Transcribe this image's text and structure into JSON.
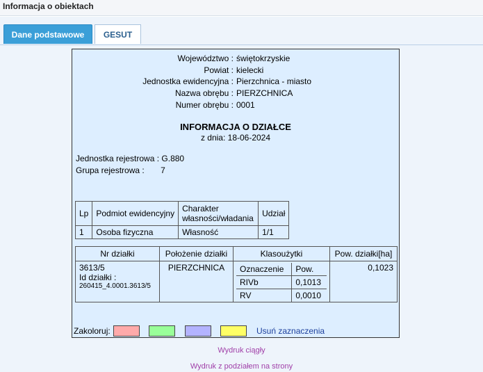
{
  "window": {
    "title": "Informacja o obiektach"
  },
  "tabs": {
    "active": "Dane podstawowe",
    "inactive": "GESUT"
  },
  "location": [
    {
      "label": "Województwo :",
      "value": "świętokrzyskie"
    },
    {
      "label": "Powiat :",
      "value": "kielecki"
    },
    {
      "label": "Jednostka ewidencyjna :",
      "value": "Pierzchnica - miasto"
    },
    {
      "label": "Nazwa obrębu :",
      "value": "PIERZCHNICA"
    },
    {
      "label": "Numer obrębu :",
      "value": "0001"
    }
  ],
  "heading": {
    "title": "INFORMACJA O DZIAŁCE",
    "date": "z dnia: 18-06-2024"
  },
  "registry": {
    "unit_label": "Jednostka rejestrowa : ",
    "unit_value": "G.880",
    "group_label": "Grupa rejestrowa :",
    "group_value": "7"
  },
  "owners_table": {
    "headers": [
      "Lp",
      "Podmiot ewidencyjny",
      "Charakter własności/władania",
      "Udział"
    ],
    "rows": [
      [
        "1",
        "Osoba fizyczna",
        "Własność",
        "1/1"
      ]
    ]
  },
  "parcel_table": {
    "headers": [
      "Nr działki",
      "Położenie działki",
      "Klasoużytki",
      "Pow. działki[ha]"
    ],
    "nr": "3613/5",
    "id_label": "Id działki :",
    "id_value": "260415_4.0001.3613/5",
    "location": "PIERZCHNICA",
    "classes": [
      [
        "Oznaczenie",
        "Pow."
      ],
      [
        "RIVb",
        "0,1013"
      ],
      [
        "RV",
        "0,0010"
      ]
    ],
    "area": "0,1023"
  },
  "footer": {
    "color_label": "Zakoloruj:",
    "swatches": [
      "#ffaaaa",
      "#99ff99",
      "#b3b3ff",
      "#ffff66"
    ],
    "clear_link": "Usuń zaznaczenia"
  },
  "print_links": {
    "continuous": "Wydruk ciągły",
    "paged": "Wydruk z podziałem na strony"
  }
}
